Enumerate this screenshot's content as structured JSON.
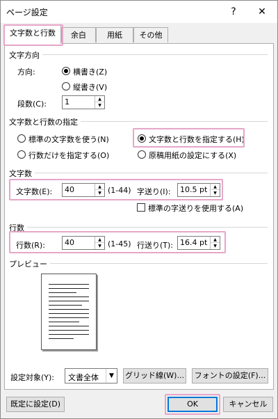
{
  "window": {
    "title": "ページ設定",
    "help_glyph": "?",
    "close_glyph": "✕"
  },
  "tabs": [
    "文字数と行数",
    "余白",
    "用紙",
    "その他"
  ],
  "direction": {
    "group_label": "文字方向",
    "label": "方向:",
    "options": [
      "横書き(Z)",
      "縦書き(V)"
    ],
    "selected": "横書き(Z)",
    "columns_label": "段数(C):",
    "columns_value": "1"
  },
  "grid_spec": {
    "group_label": "文字数と行数の指定",
    "options": [
      "標準の文字数を使う(N)",
      "文字数と行数を指定する(H)",
      "行数だけを指定する(O)",
      "原稿用紙の設定にする(X)"
    ],
    "selected": "文字数と行数を指定する(H)"
  },
  "chars": {
    "group_label": "文字数",
    "count_label": "文字数(E):",
    "count_value": "40",
    "range": "(1-44)",
    "pitch_label": "字送り(I):",
    "pitch_value": "10.5 pt",
    "default_pitch_label": "標準の字送りを使用する(A)"
  },
  "lines": {
    "group_label": "行数",
    "count_label": "行数(R):",
    "count_value": "40",
    "range": "(1-45)",
    "pitch_label": "行送り(T):",
    "pitch_value": "16.4 pt"
  },
  "preview": {
    "group_label": "プレビュー"
  },
  "apply": {
    "label": "設定対象(Y):",
    "value": "文書全体",
    "grid_button": "グリッド線(W)...",
    "font_button": "フォントの設定(F)..."
  },
  "footer": {
    "default_button": "既定に設定(D)",
    "ok_button": "OK",
    "cancel_button": "キャンセル"
  },
  "highlight_color": "#e6a6c8"
}
